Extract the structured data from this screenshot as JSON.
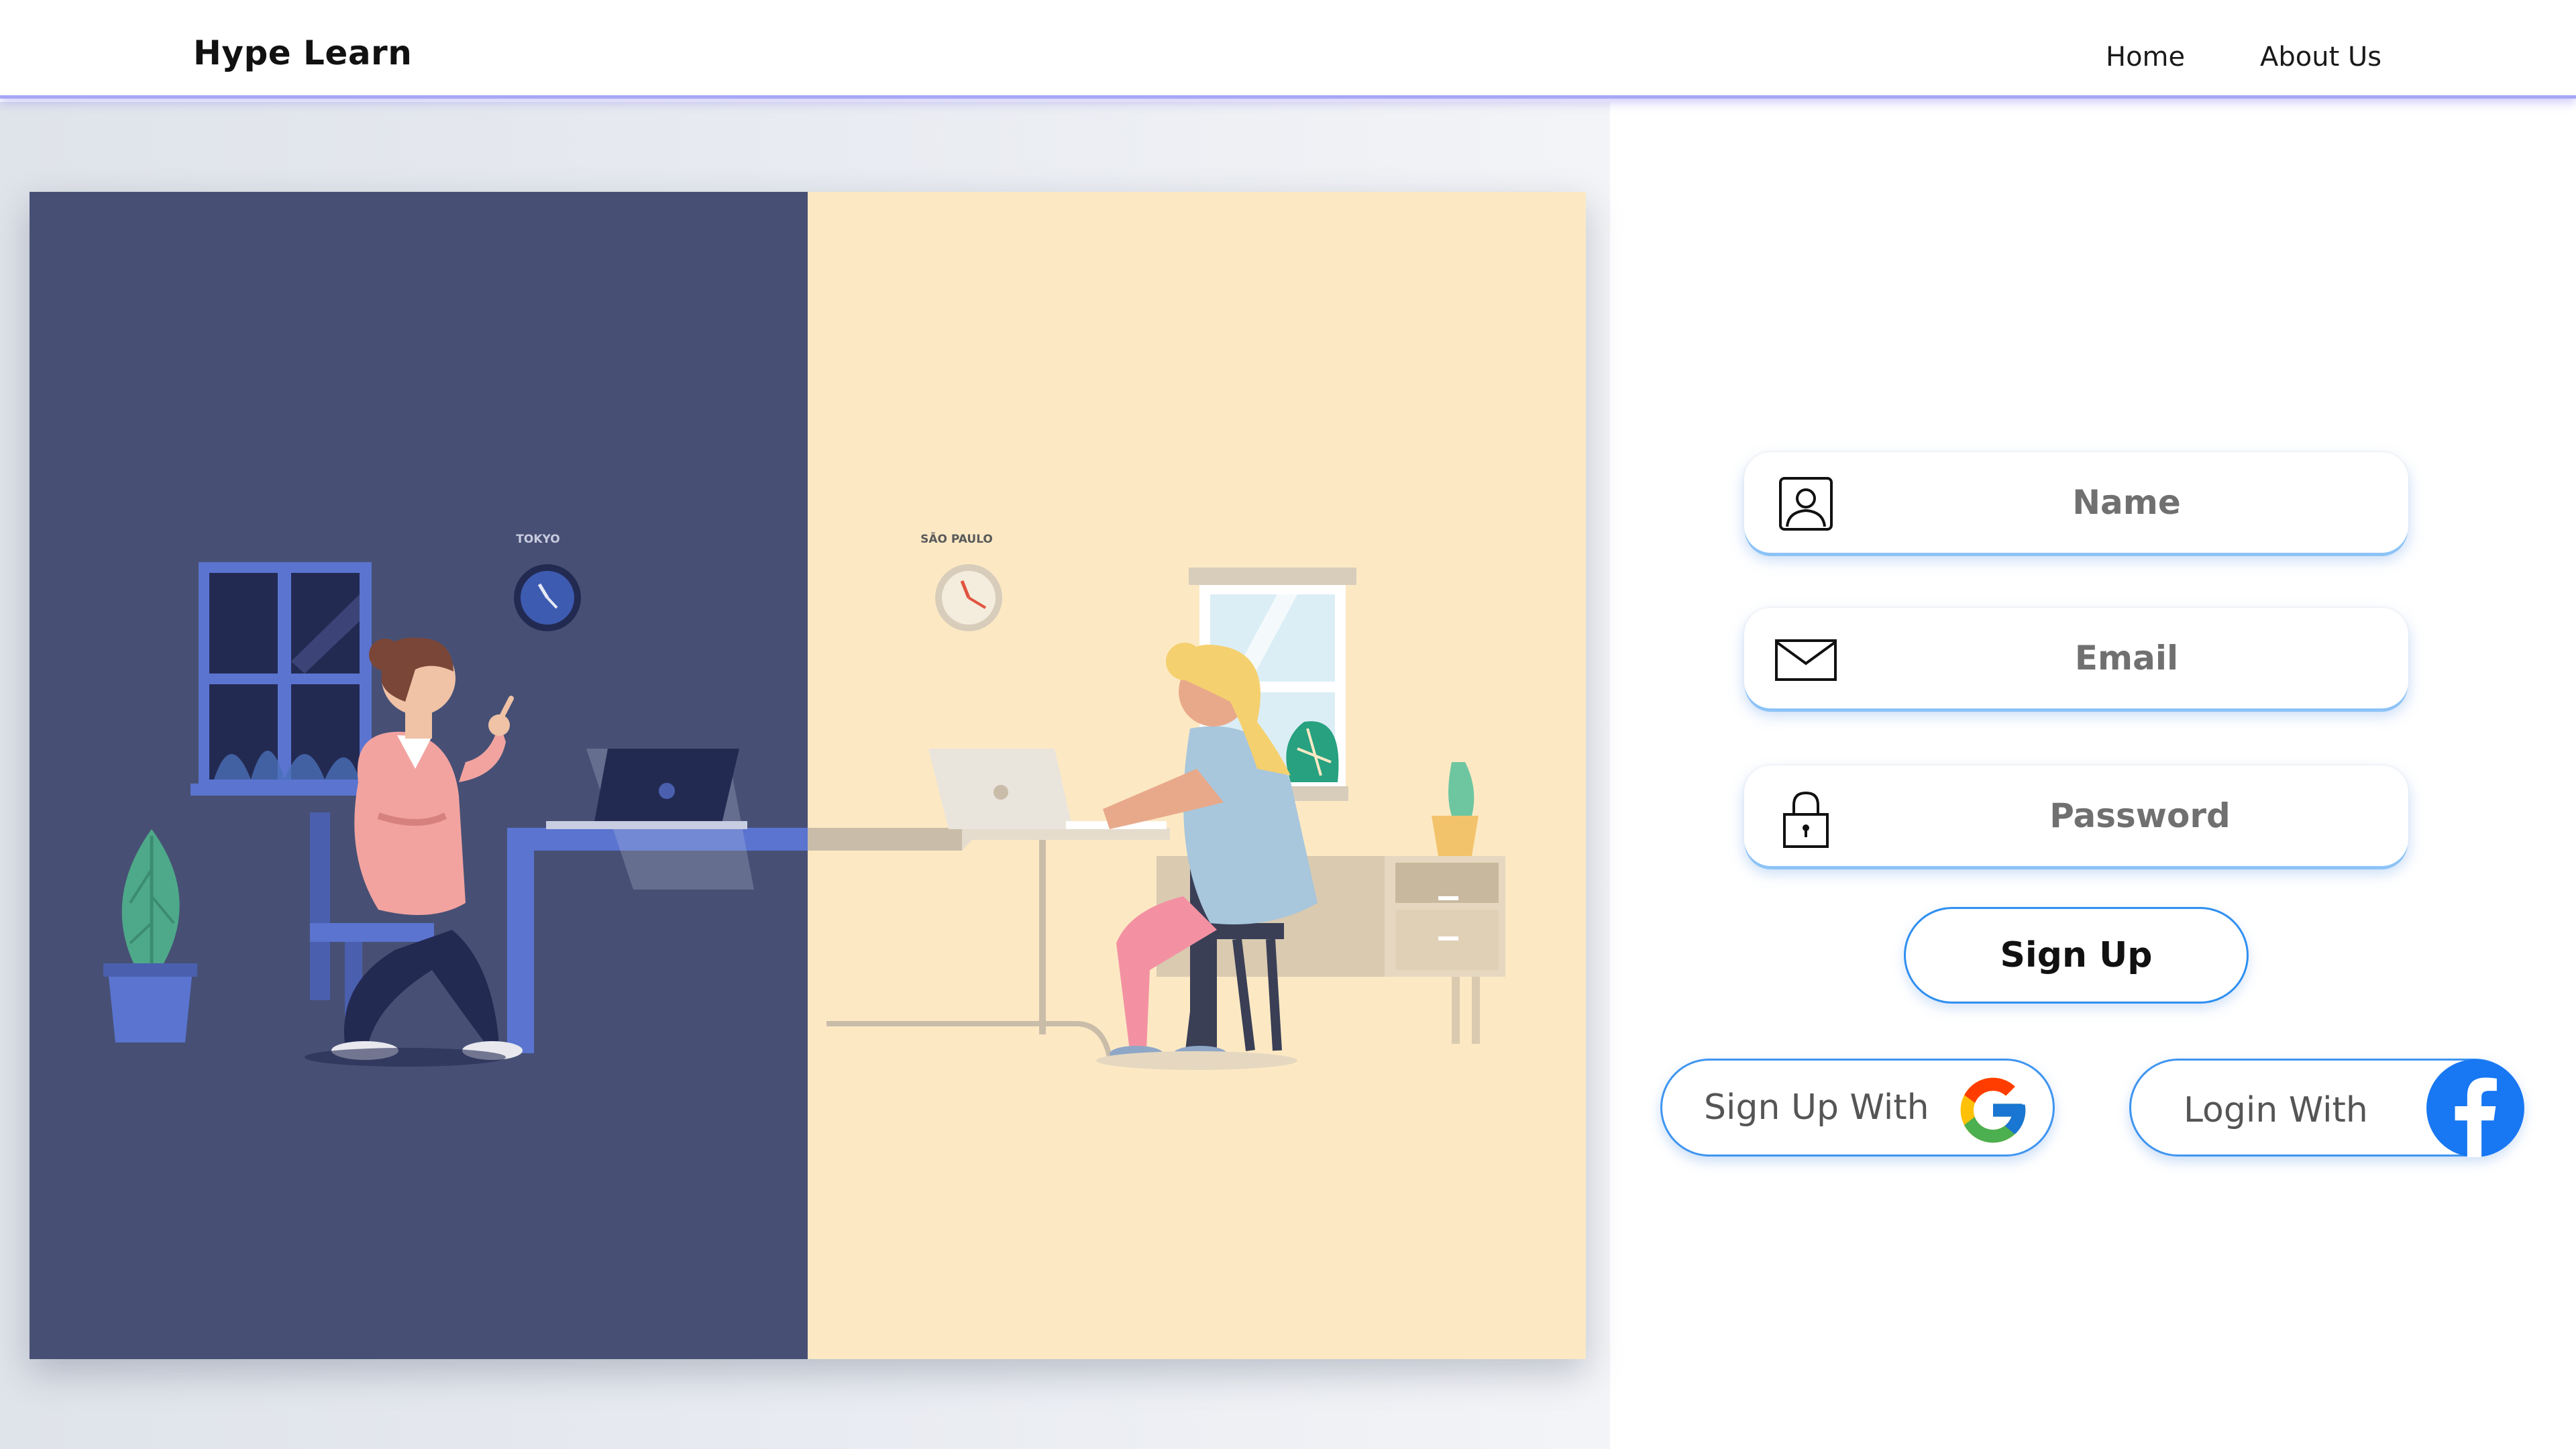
{
  "app": {
    "brand": "Hype Learn"
  },
  "nav": {
    "items": [
      {
        "label": "Home"
      },
      {
        "label": "About Us"
      }
    ]
  },
  "illustration": {
    "left_clock_label": "TOKYO",
    "right_clock_label": "SÃO PAULO"
  },
  "form": {
    "name": {
      "placeholder": "Name",
      "icon": "user-icon"
    },
    "email": {
      "placeholder": "Email",
      "icon": "envelope-icon"
    },
    "password": {
      "placeholder": "Password",
      "icon": "padlock-icon"
    },
    "signup_label": "Sign Up",
    "google_label": "Sign Up With",
    "facebook_label": "Login With"
  },
  "colors": {
    "accent_blue": "#2f8ff0",
    "navbar_border": "#a8a6f5",
    "night_panel": "#475074",
    "day_panel": "#fce9c4"
  }
}
